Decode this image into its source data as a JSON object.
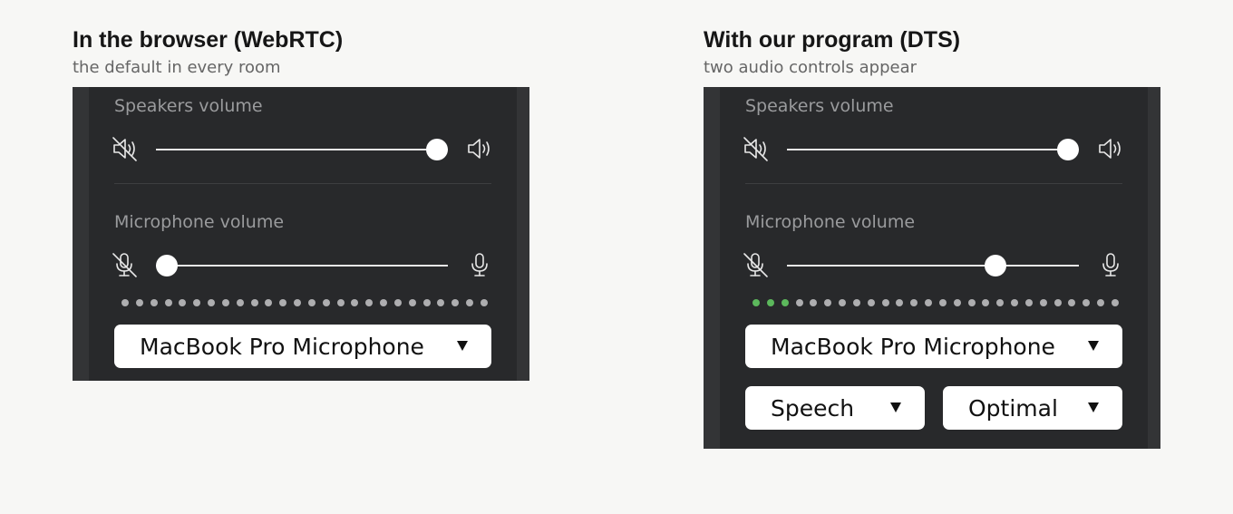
{
  "colors": {
    "meter_on": "#5cb85c",
    "meter_off": "#aeaeb0"
  },
  "left": {
    "title": "In the browser (WebRTC)",
    "subtitle": "the default in every room",
    "speakers_label": "Speakers volume",
    "speakers_volume": 1.0,
    "mic_label": "Microphone volume",
    "mic_volume": 0.0,
    "meter_dots": 26,
    "meter_active": 0,
    "device": "MacBook Pro Microphone",
    "icons": [
      "speaker-muted-icon",
      "speaker-loud-icon",
      "mic-muted-icon",
      "mic-icon",
      "dropdown-arrow-icon"
    ]
  },
  "right": {
    "title": "With our program (DTS)",
    "subtitle": "two audio controls appear",
    "speakers_label": "Speakers volume",
    "speakers_volume": 1.0,
    "mic_label": "Microphone volume",
    "mic_volume": 0.73,
    "meter_dots": 26,
    "meter_active": 3,
    "device": "MacBook Pro Microphone",
    "mode": "Speech",
    "quality": "Optimal"
  }
}
